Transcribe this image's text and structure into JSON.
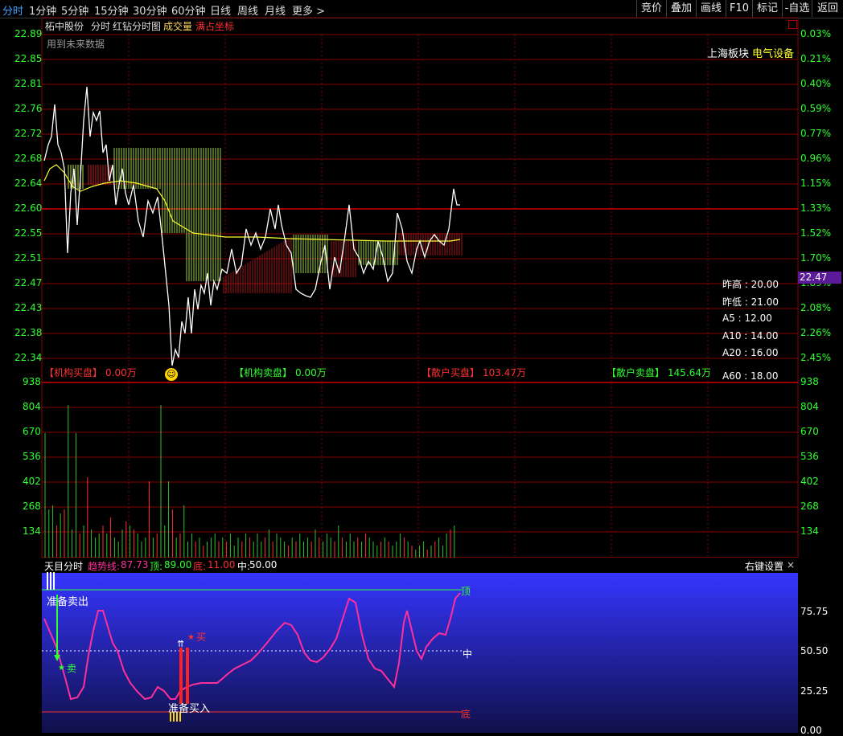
{
  "toolbar": {
    "periods": [
      {
        "label": "分时",
        "active": true
      },
      {
        "label": "1分钟"
      },
      {
        "label": "5分钟"
      },
      {
        "label": "15分钟"
      },
      {
        "label": "30分钟"
      },
      {
        "label": "60分钟"
      },
      {
        "label": "日线"
      },
      {
        "label": "周线"
      },
      {
        "label": "月线"
      },
      {
        "label": "更多 >"
      }
    ],
    "buttons": [
      "竞价",
      "叠加",
      "画线",
      "F10",
      "标记",
      "-自选",
      "返回"
    ]
  },
  "header": {
    "stock_name": "柘中股份",
    "chart_kind": "分时",
    "indicator": "红钻分时图",
    "volume_label": "成交量",
    "fill_label": "满占坐标",
    "note": "用到未来数据",
    "sector_label": "上海板块",
    "sector_value": "电气设备"
  },
  "price_axis": {
    "left": [
      "22.89",
      "22.85",
      "22.81",
      "22.76",
      "22.72",
      "22.68",
      "22.64",
      "22.60",
      "22.55",
      "22.51",
      "22.47",
      "22.43",
      "22.38",
      "22.34"
    ],
    "right": [
      "0.03%",
      "0.21%",
      "0.40%",
      "0.59%",
      "0.77%",
      "0.96%",
      "1.15%",
      "1.33%",
      "1.52%",
      "1.70%",
      "1.89%",
      "2.08%",
      "2.26%",
      "2.45%"
    ],
    "current_price": "22.47"
  },
  "stats": [
    {
      "label": "昨高",
      "value": "20.00"
    },
    {
      "label": "昨低",
      "value": "21.00"
    },
    {
      "label": "A5",
      "value": "12.00"
    },
    {
      "label": "A10",
      "value": "14.00"
    },
    {
      "label": "A20",
      "value": "16.00"
    },
    {
      "label": "A60",
      "value": "18.00"
    }
  ],
  "flows": [
    {
      "label": "【机构买盘】",
      "value": "0.00万",
      "color": "#ff3030"
    },
    {
      "label": "【机构卖盘】",
      "value": "0.00万",
      "color": "#30ff30"
    },
    {
      "label": "【散户买盘】",
      "value": "103.47万",
      "color": "#ff3030"
    },
    {
      "label": "【散户卖盘】",
      "value": "145.64万",
      "color": "#30ff30"
    }
  ],
  "volume_axis": [
    "938",
    "804",
    "670",
    "536",
    "402",
    "268",
    "134"
  ],
  "indicator_panel": {
    "name": "天目分时",
    "trend_label": "趋势线:",
    "trend_value": "87.73",
    "top_label": "顶:",
    "top_value": "89.00",
    "bottom_label": "底:",
    "bottom_value": "11.00",
    "mid_label": "中:",
    "mid_value": "50.00",
    "settings": "右键设置",
    "close": "×",
    "axis": [
      "75.75",
      "50.50",
      "25.25",
      "0.00"
    ],
    "line_top": "顶",
    "line_mid": "中",
    "line_bottom": "底",
    "sell_prepare": "准备卖出",
    "buy_prepare": "准备买入",
    "sell_mark": "卖",
    "buy_mark": "买"
  },
  "colors": {
    "price_line": "#ffffff",
    "avg_line": "#ffff30",
    "up": "#ff3030",
    "down": "#30ff30",
    "grid": "#8a0000",
    "trend": "#ff2f9a",
    "panel_bg": "#2a2aff"
  }
}
